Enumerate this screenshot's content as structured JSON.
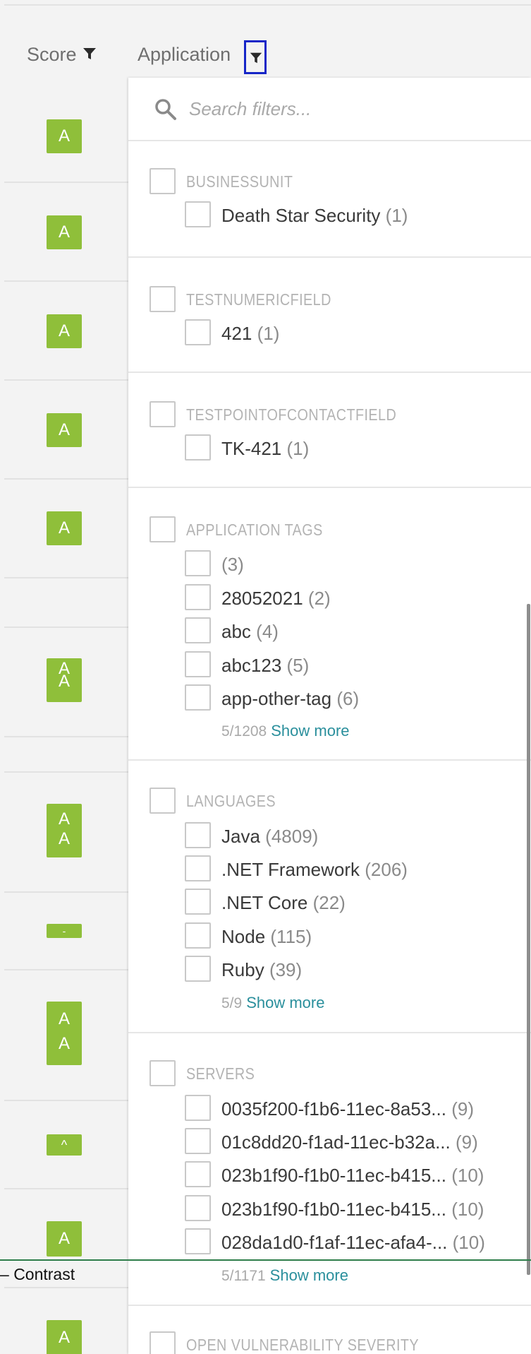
{
  "header": {
    "score_label": "Score",
    "application_label": "Application"
  },
  "table": {
    "badges": [
      "A",
      "A",
      "A",
      "A",
      "A",
      "A\nA",
      "A\nA",
      "-",
      "A\nA",
      "^",
      "A",
      "A"
    ]
  },
  "filter_panel": {
    "search": {
      "placeholder": "Search filters..."
    },
    "sections": [
      {
        "title": "BUSINESSUNIT",
        "options": [
          {
            "label": "Death Star Security",
            "count": "(1)"
          }
        ]
      },
      {
        "title": "TESTNUMERICFIELD",
        "options": [
          {
            "label": "421",
            "count": "(1)"
          }
        ]
      },
      {
        "title": "TESTPOINTOFCONTACTFIELD",
        "options": [
          {
            "label": "TK-421",
            "count": "(1)"
          }
        ]
      },
      {
        "title": "APPLICATION TAGS",
        "options": [
          {
            "label": "",
            "count": "(3)"
          },
          {
            "label": "28052021",
            "count": "(2)"
          },
          {
            "label": "abc",
            "count": "(4)"
          },
          {
            "label": "abc123",
            "count": "(5)"
          },
          {
            "label": "app-other-tag",
            "count": "(6)"
          }
        ],
        "more_count": "5/1208",
        "more_label": "Show more"
      },
      {
        "title": "LANGUAGES",
        "options": [
          {
            "label": "Java",
            "count": "(4809)"
          },
          {
            "label": ".NET Framework",
            "count": "(206)"
          },
          {
            "label": ".NET Core",
            "count": "(22)"
          },
          {
            "label": "Node",
            "count": "(115)"
          },
          {
            "label": "Ruby",
            "count": "(39)"
          }
        ],
        "more_count": "5/9",
        "more_label": "Show more"
      },
      {
        "title": "SERVERS",
        "options": [
          {
            "label": "0035f200-f1b6-11ec-8a53...",
            "count": "(9)"
          },
          {
            "label": "01c8dd20-f1ad-11ec-b32a...",
            "count": "(9)"
          },
          {
            "label": "023b1f90-f1b0-11ec-b415...",
            "count": "(10)"
          },
          {
            "label": "023b1f90-f1b0-11ec-b415...",
            "count": "(10)"
          },
          {
            "label": "028da1d0-f1af-11ec-afa4-...",
            "count": "(10)"
          }
        ],
        "more_count": "5/1171",
        "more_label": "Show more"
      },
      {
        "title": "OPEN VULNERABILITY SEVERITY",
        "options": []
      }
    ]
  },
  "overlay": {
    "contrast_label": "Contrast"
  },
  "colors": {
    "badge_green": "#8fbf3a",
    "link_teal": "#2a8f9c",
    "focus_blue": "#1626c7"
  }
}
